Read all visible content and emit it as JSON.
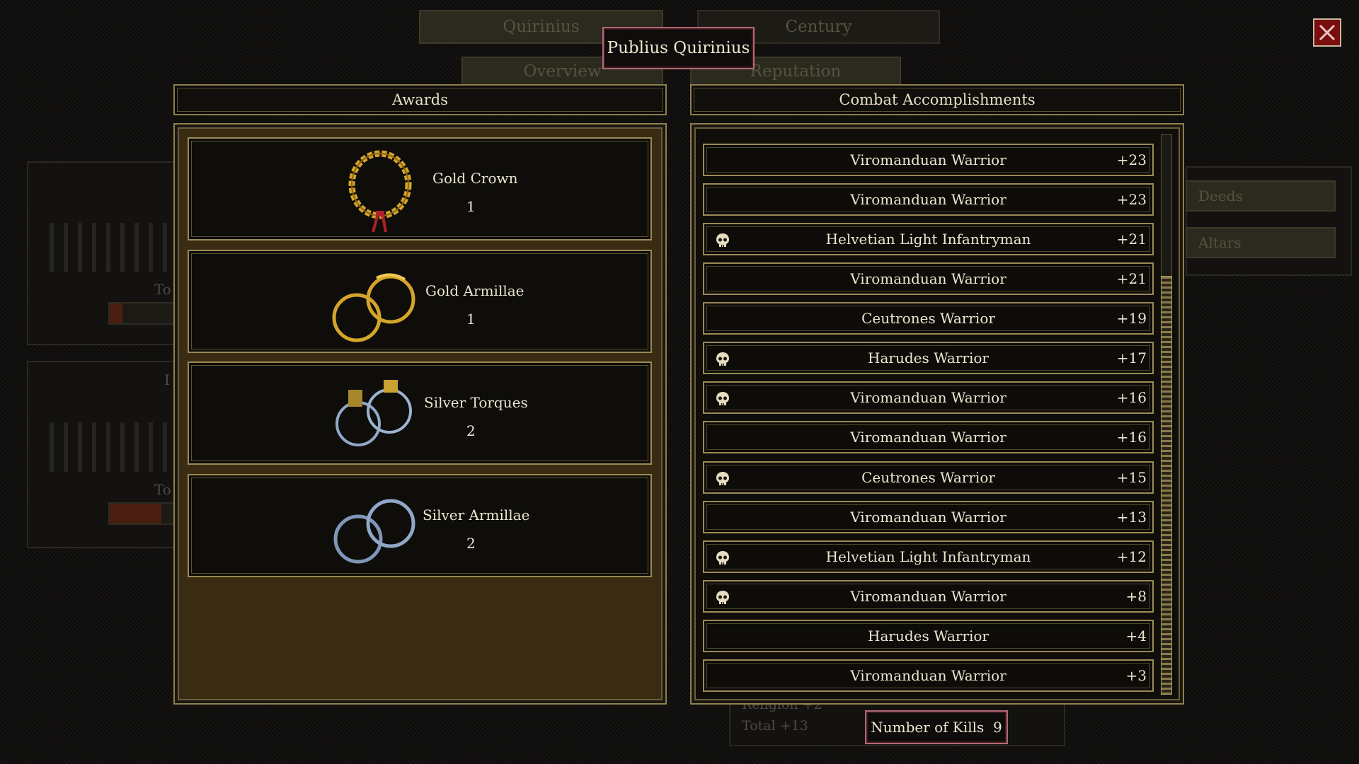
{
  "character_name": "Publius Quirinius",
  "top_tabs": [
    "Quirinius",
    "Century"
  ],
  "sub_tabs": [
    "Overview",
    "Reputation"
  ],
  "right_tabs": [
    "Deeds",
    "Altars"
  ],
  "background_labels": {
    "religion": "Religion +2",
    "total": "Total +13",
    "to1": "To",
    "to2": "To",
    "i": "I"
  },
  "awards": {
    "title": "Awards",
    "items": [
      {
        "name": "Gold Crown",
        "count": "1",
        "icon": "laurel-crown-icon"
      },
      {
        "name": "Gold Armillae",
        "count": "1",
        "icon": "gold-rings-icon"
      },
      {
        "name": "Silver Torques",
        "count": "2",
        "icon": "silver-torques-icon"
      },
      {
        "name": "Silver Armillae",
        "count": "2",
        "icon": "silver-rings-icon"
      }
    ]
  },
  "combat": {
    "title": "Combat Accomplishments",
    "rows": [
      {
        "name": "Viromanduan Warrior",
        "score": "+23",
        "killed": false
      },
      {
        "name": "Viromanduan Warrior",
        "score": "+23",
        "killed": false
      },
      {
        "name": "Helvetian Light Infantryman",
        "score": "+21",
        "killed": true
      },
      {
        "name": "Viromanduan Warrior",
        "score": "+21",
        "killed": false
      },
      {
        "name": "Ceutrones Warrior",
        "score": "+19",
        "killed": false
      },
      {
        "name": "Harudes Warrior",
        "score": "+17",
        "killed": true
      },
      {
        "name": "Viromanduan Warrior",
        "score": "+16",
        "killed": true
      },
      {
        "name": "Viromanduan Warrior",
        "score": "+16",
        "killed": false
      },
      {
        "name": "Ceutrones Warrior",
        "score": "+15",
        "killed": true
      },
      {
        "name": "Viromanduan Warrior",
        "score": "+13",
        "killed": false
      },
      {
        "name": "Helvetian Light Infantryman",
        "score": "+12",
        "killed": true
      },
      {
        "name": "Viromanduan Warrior",
        "score": "+8",
        "killed": true
      },
      {
        "name": "Harudes Warrior",
        "score": "+4",
        "killed": false
      },
      {
        "name": "Viromanduan Warrior",
        "score": "+3",
        "killed": false
      }
    ]
  },
  "kills": {
    "label": "Number of Kills",
    "value": "9"
  },
  "colors": {
    "gold": "#d4a52a",
    "silver": "#8fa8c8",
    "frame": "#8e7f4e",
    "close": "#7a0d0d"
  }
}
